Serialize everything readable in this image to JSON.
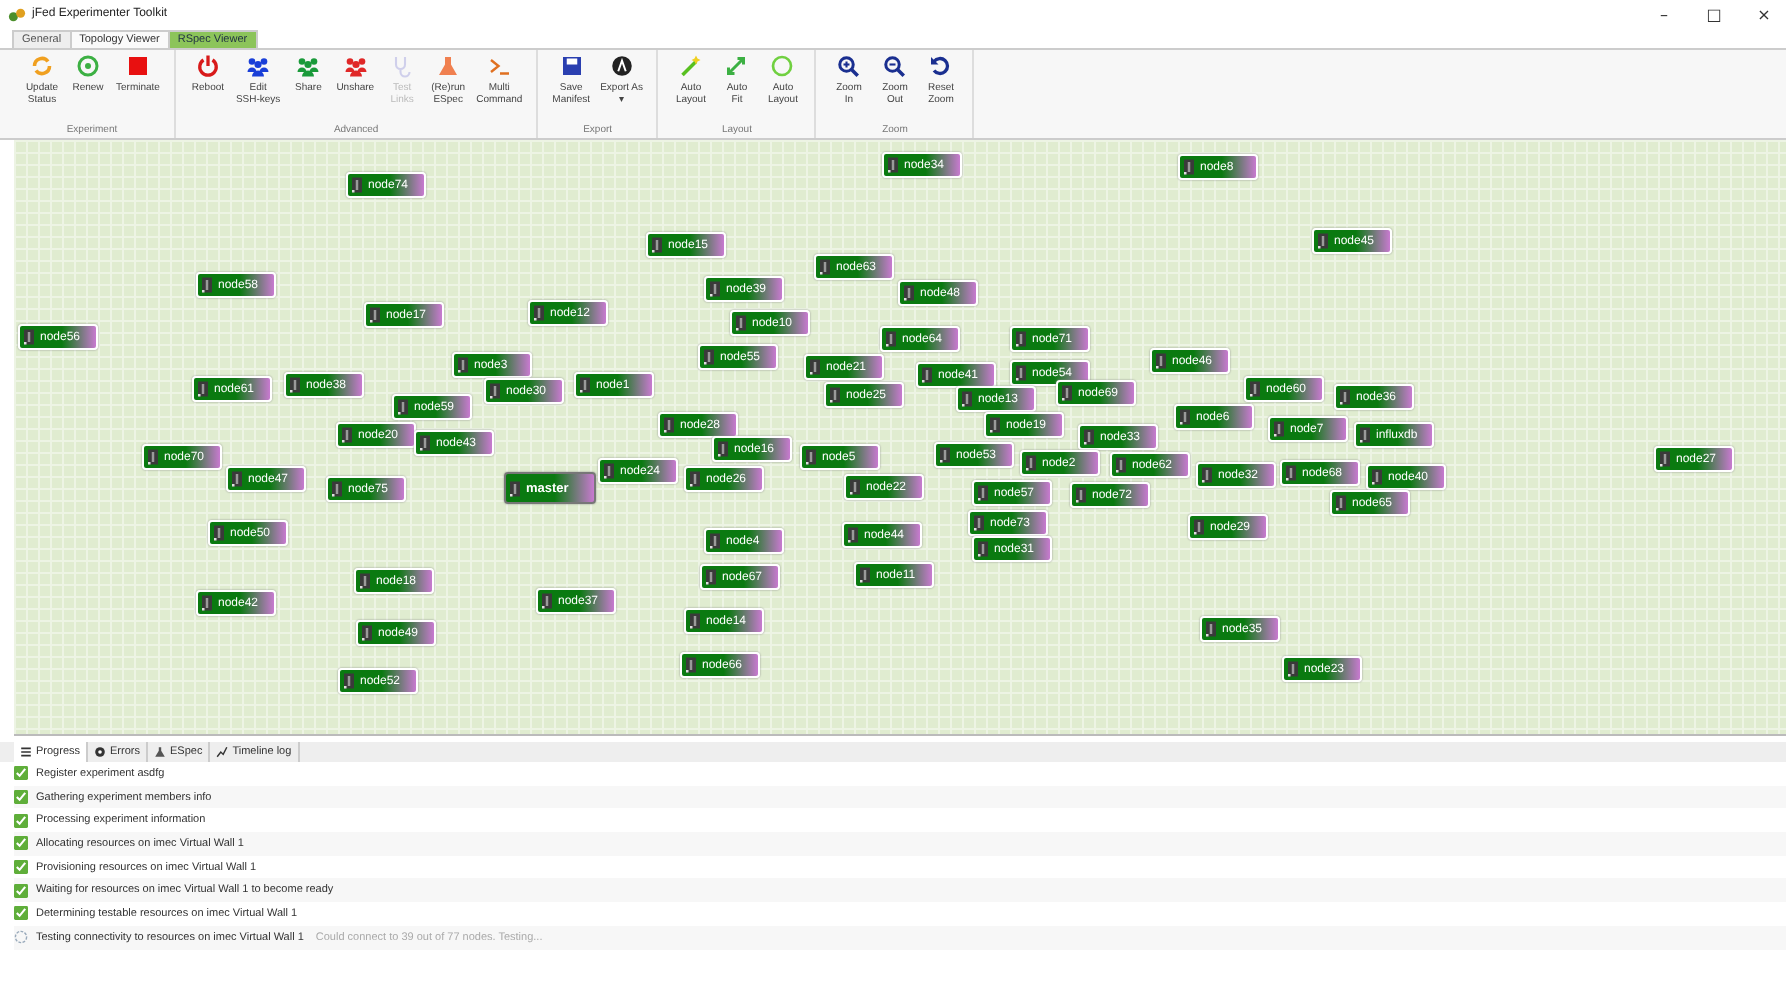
{
  "window": {
    "title": "jFed Experimenter Toolkit",
    "controls": [
      "–",
      "□",
      "×"
    ]
  },
  "tabs": [
    {
      "label": "General",
      "selected": false
    },
    {
      "label": "Topology Viewer",
      "selected": true
    },
    {
      "label": "RSpec Viewer",
      "selected": false
    }
  ],
  "toolbar": [
    {
      "group": "Experiment",
      "buttons": [
        {
          "lines": [
            "Update",
            "Status"
          ],
          "disabled": false
        },
        {
          "lines": [
            "Renew"
          ],
          "disabled": false
        },
        {
          "lines": [
            "Terminate"
          ],
          "disabled": false
        }
      ]
    },
    {
      "group": "Advanced",
      "buttons": [
        {
          "lines": [
            "Reboot"
          ],
          "disabled": false
        },
        {
          "lines": [
            "Edit",
            "SSH-keys"
          ],
          "disabled": false
        },
        {
          "lines": [
            "Share"
          ],
          "disabled": false
        },
        {
          "lines": [
            "Unshare"
          ],
          "disabled": false
        },
        {
          "lines": [
            "Test",
            "Links"
          ],
          "disabled": true
        },
        {
          "lines": [
            "(Re)run",
            "ESpec"
          ],
          "disabled": false
        },
        {
          "lines": [
            "Multi",
            "Command"
          ],
          "disabled": false
        }
      ]
    },
    {
      "group": "Export",
      "buttons": [
        {
          "lines": [
            "Save",
            "Manifest"
          ],
          "disabled": false
        },
        {
          "lines": [
            "Export As",
            "▾"
          ],
          "disabled": false
        }
      ]
    },
    {
      "group": "Layout",
      "buttons": [
        {
          "lines": [
            "Auto",
            "Layout"
          ],
          "disabled": false
        },
        {
          "lines": [
            "Auto",
            "Fit"
          ],
          "disabled": false
        },
        {
          "lines": [
            "Auto",
            "Layout"
          ],
          "disabled": false
        }
      ]
    },
    {
      "group": "Zoom",
      "buttons": [
        {
          "lines": [
            "Zoom",
            "In"
          ],
          "disabled": false
        },
        {
          "lines": [
            "Zoom",
            "Out"
          ],
          "disabled": false
        },
        {
          "lines": [
            "Reset",
            "Zoom"
          ],
          "disabled": false
        }
      ]
    }
  ],
  "nodes": [
    {
      "name": "node34",
      "kind": "node"
    },
    {
      "name": "node8",
      "kind": "node"
    },
    {
      "name": "node74",
      "kind": "node"
    },
    {
      "name": "node15",
      "kind": "node"
    },
    {
      "name": "node45",
      "kind": "node"
    },
    {
      "name": "node58",
      "kind": "node"
    },
    {
      "name": "node39",
      "kind": "node"
    },
    {
      "name": "node63",
      "kind": "node"
    },
    {
      "name": "node48",
      "kind": "node"
    },
    {
      "name": "node56",
      "kind": "node"
    },
    {
      "name": "node17",
      "kind": "node"
    },
    {
      "name": "node12",
      "kind": "node"
    },
    {
      "name": "node10",
      "kind": "node"
    },
    {
      "name": "node64",
      "kind": "node"
    },
    {
      "name": "node71",
      "kind": "node"
    },
    {
      "name": "node3",
      "kind": "node"
    },
    {
      "name": "node55",
      "kind": "node"
    },
    {
      "name": "node21",
      "kind": "node"
    },
    {
      "name": "node41",
      "kind": "node"
    },
    {
      "name": "node54",
      "kind": "node"
    },
    {
      "name": "node46",
      "kind": "node"
    },
    {
      "name": "node61",
      "kind": "node"
    },
    {
      "name": "node38",
      "kind": "node"
    },
    {
      "name": "node59",
      "kind": "node"
    },
    {
      "name": "node30",
      "kind": "node"
    },
    {
      "name": "node1",
      "kind": "node"
    },
    {
      "name": "node25",
      "kind": "node"
    },
    {
      "name": "node13",
      "kind": "node"
    },
    {
      "name": "node69",
      "kind": "node"
    },
    {
      "name": "node60",
      "kind": "node"
    },
    {
      "name": "node36",
      "kind": "node"
    },
    {
      "name": "node20",
      "kind": "node"
    },
    {
      "name": "node43",
      "kind": "node"
    },
    {
      "name": "node28",
      "kind": "node"
    },
    {
      "name": "node19",
      "kind": "node"
    },
    {
      "name": "node33",
      "kind": "node"
    },
    {
      "name": "node6",
      "kind": "node"
    },
    {
      "name": "node7",
      "kind": "node"
    },
    {
      "name": "influxdb",
      "kind": "node"
    },
    {
      "name": "node70",
      "kind": "node"
    },
    {
      "name": "node47",
      "kind": "node"
    },
    {
      "name": "node75",
      "kind": "node"
    },
    {
      "name": "master",
      "kind": "master"
    },
    {
      "name": "node24",
      "kind": "node"
    },
    {
      "name": "node26",
      "kind": "node"
    },
    {
      "name": "node16",
      "kind": "node"
    },
    {
      "name": "node5",
      "kind": "node"
    },
    {
      "name": "node22",
      "kind": "node"
    },
    {
      "name": "node53",
      "kind": "node"
    },
    {
      "name": "node57",
      "kind": "node"
    },
    {
      "name": "node2",
      "kind": "node"
    },
    {
      "name": "node72",
      "kind": "node"
    },
    {
      "name": "node62",
      "kind": "node"
    },
    {
      "name": "node32",
      "kind": "node"
    },
    {
      "name": "node68",
      "kind": "node"
    },
    {
      "name": "node40",
      "kind": "node"
    },
    {
      "name": "node27",
      "kind": "node"
    },
    {
      "name": "node50",
      "kind": "node"
    },
    {
      "name": "node73",
      "kind": "node"
    },
    {
      "name": "node31",
      "kind": "node"
    },
    {
      "name": "node29",
      "kind": "node"
    },
    {
      "name": "node65",
      "kind": "node"
    },
    {
      "name": "node4",
      "kind": "node"
    },
    {
      "name": "node44",
      "kind": "node"
    },
    {
      "name": "node18",
      "kind": "node"
    },
    {
      "name": "node67",
      "kind": "node"
    },
    {
      "name": "node11",
      "kind": "node"
    },
    {
      "name": "node42",
      "kind": "node"
    },
    {
      "name": "node37",
      "kind": "node"
    },
    {
      "name": "node49",
      "kind": "node"
    },
    {
      "name": "node14",
      "kind": "node"
    },
    {
      "name": "node35",
      "kind": "node"
    },
    {
      "name": "node52",
      "kind": "node"
    },
    {
      "name": "node66",
      "kind": "node"
    },
    {
      "name": "node23",
      "kind": "node"
    }
  ],
  "log_tabs": [
    {
      "label": "Progress",
      "selected": true
    },
    {
      "label": "Errors",
      "selected": false
    },
    {
      "label": "ESpec",
      "selected": false
    },
    {
      "label": "Timeline log",
      "selected": false
    }
  ],
  "log": [
    {
      "text": "Register experiment asdfg",
      "done": true
    },
    {
      "text": "Gathering experiment members info",
      "done": true
    },
    {
      "text": "Processing experiment information",
      "done": true
    },
    {
      "text": "Allocating resources on imec Virtual Wall 1",
      "done": true
    },
    {
      "text": "Provisioning resources on imec Virtual Wall 1",
      "done": true
    },
    {
      "text": "Waiting for resources on imec Virtual Wall 1 to become ready",
      "done": true
    },
    {
      "text": "Determining testable resources on imec Virtual Wall 1",
      "done": true
    },
    {
      "text": "Testing connectivity to resources on imec Virtual Wall 1",
      "detail": "Could connect to 39 out of 77 nodes. Testing...",
      "done": false
    }
  ]
}
